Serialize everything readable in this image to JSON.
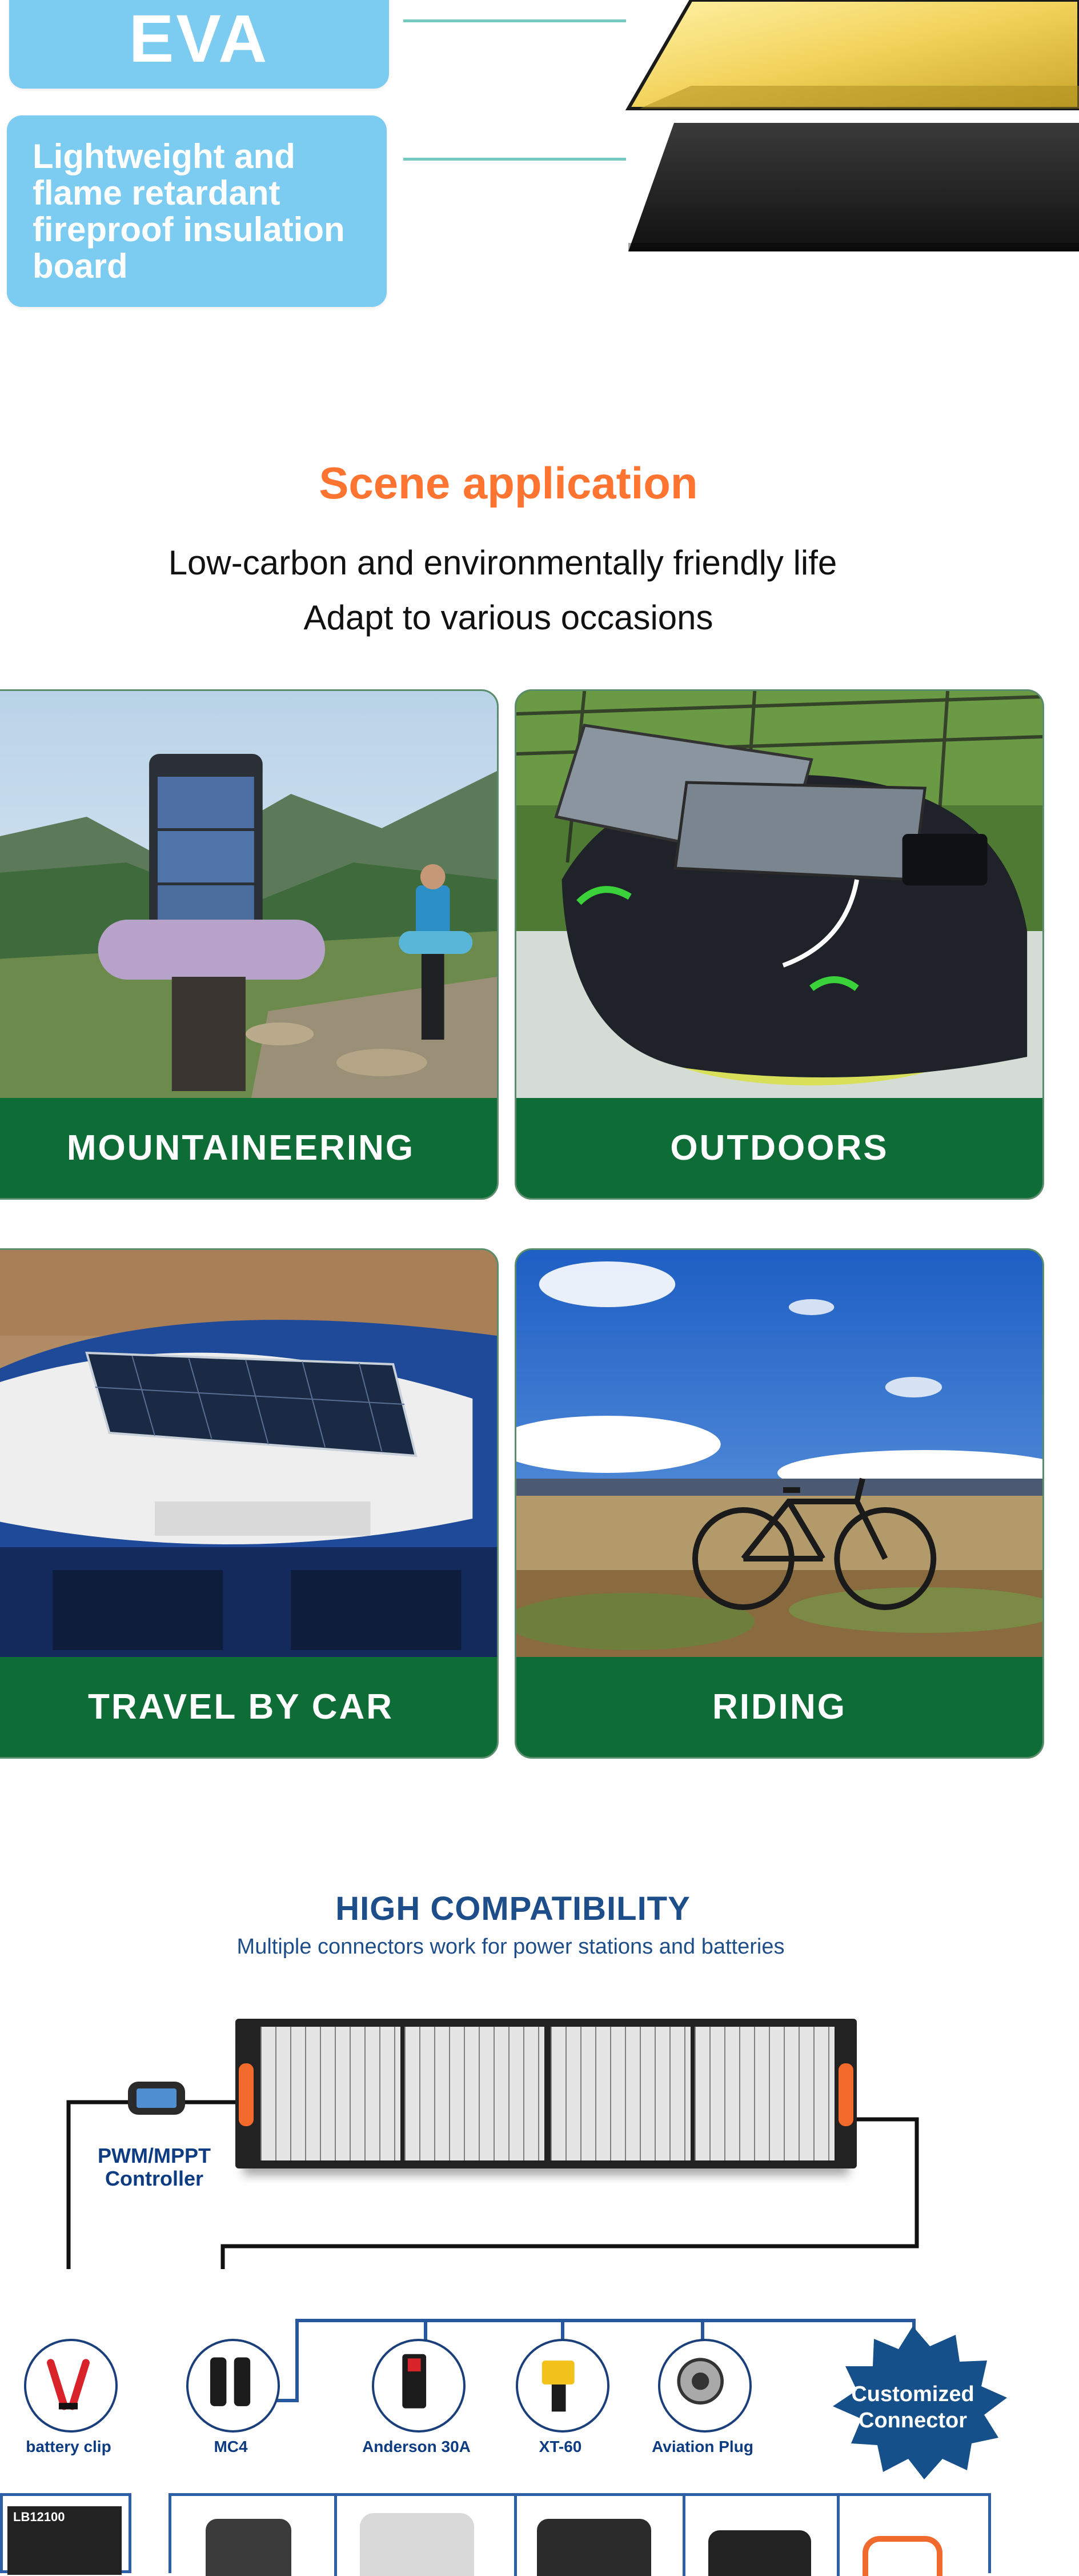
{
  "layers": {
    "eva_label": "EVA",
    "board_label": "Lightweight and flame retardant fireproof insulation board",
    "board_lines": [
      "Lightweight and",
      "flame retardant",
      "fireproof insulation",
      "board"
    ]
  },
  "scene": {
    "title": "Scene application",
    "subtitle_1": "Low-carbon and environmentally friendly life",
    "subtitle_2": "Adapt to various occasions",
    "cards": [
      {
        "label": "MOUNTAINEERING"
      },
      {
        "label": "OUTDOORS"
      },
      {
        "label": "TRAVEL BY CAR"
      },
      {
        "label": "RIDING"
      }
    ]
  },
  "compatibility": {
    "title": "HIGH COMPATIBILITY",
    "subtitle": "Multiple connectors work for power stations and batteries",
    "controller_label_1": "PWM/MPPT",
    "controller_label_2": "Controller",
    "connectors": [
      "battery clip",
      "MC4",
      "Anderson 30A",
      "XT-60",
      "Aviation Plug"
    ],
    "badge_line_1": "Customized",
    "badge_line_2": "Connector",
    "battery_text": "LB12100"
  },
  "colors": {
    "accent_orange": "#ff7430",
    "card_green": "#0e6d36",
    "pill_blue": "#7ccbf0",
    "compat_blue": "#1d4e8a"
  }
}
